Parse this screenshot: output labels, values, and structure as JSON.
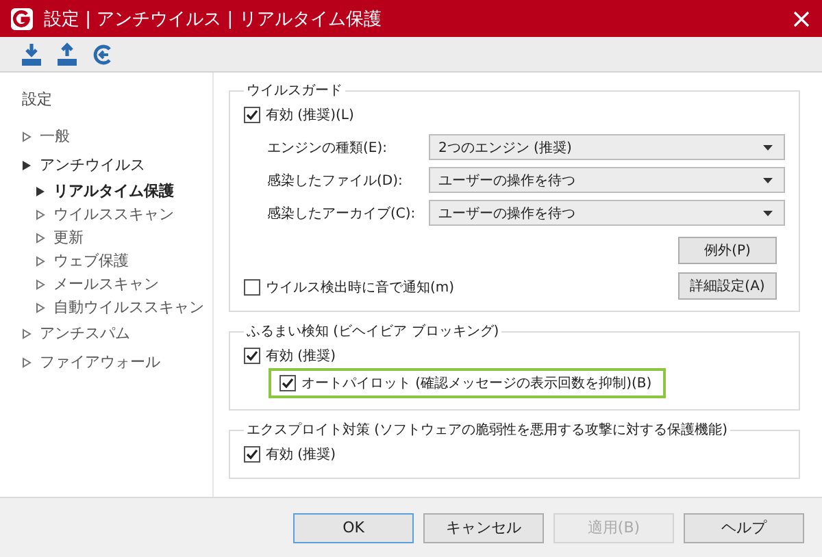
{
  "window": {
    "title": "設定 | アンチウイルス | リアルタイム保護"
  },
  "toolbar": {
    "buttons": [
      {
        "kind": "import"
      },
      {
        "kind": "export"
      },
      {
        "kind": "reset"
      }
    ]
  },
  "sidebar": {
    "heading": "設定",
    "items": [
      {
        "label": "一般",
        "expanded": false,
        "selected": false
      },
      {
        "label": "アンチウイルス",
        "expanded": true,
        "selected": false,
        "children": [
          {
            "label": "リアルタイム保護",
            "selected": true
          },
          {
            "label": "ウイルススキャン",
            "selected": false
          },
          {
            "label": "更新",
            "selected": false
          },
          {
            "label": "ウェブ保護",
            "selected": false
          },
          {
            "label": "メールスキャン",
            "selected": false
          },
          {
            "label": "自動ウイルススキャン",
            "selected": false
          }
        ]
      },
      {
        "label": "アンチスパム",
        "expanded": false,
        "selected": false
      },
      {
        "label": "ファイアウォール",
        "expanded": false,
        "selected": false
      }
    ]
  },
  "virus_guard": {
    "title": "ウイルスガード",
    "enabled": {
      "label": "有効 (推奨)(L)",
      "checked": true
    },
    "selects": [
      {
        "label": "エンジンの種類(E):",
        "value": "2つのエンジン (推奨)"
      },
      {
        "label": "感染したファイル(D):",
        "value": "ユーザーの操作を待つ"
      },
      {
        "label": "感染したアーカイブ(C):",
        "value": "ユーザーの操作を待つ"
      }
    ],
    "buttons": [
      "例外(P)",
      "詳細設定(A)"
    ],
    "sound_notify": {
      "label": "ウイルス検出時に音で通知(m)",
      "checked": false
    }
  },
  "behavior_blocking": {
    "title": "ふるまい検知 (ビヘイビア ブロッキング)",
    "enabled": {
      "label": "有効 (推奨)",
      "checked": true
    },
    "autopilot": {
      "label": "オートパイロット (確認メッセージの表示回数を抑制)(B)",
      "checked": true,
      "highlighted": true
    }
  },
  "exploit_protection": {
    "title": "エクスプロイト対策 (ソフトウェアの脆弱性を悪用する攻撃に対する保護機能)",
    "enabled": {
      "label": "有効 (推奨)",
      "checked": true
    }
  },
  "footer_buttons": [
    {
      "label": "OK",
      "default": true,
      "disabled": false
    },
    {
      "label": "キャンセル",
      "default": false,
      "disabled": false
    },
    {
      "label": "適用(B)",
      "default": false,
      "disabled": true
    },
    {
      "label": "ヘルプ",
      "default": false,
      "disabled": false
    }
  ]
}
